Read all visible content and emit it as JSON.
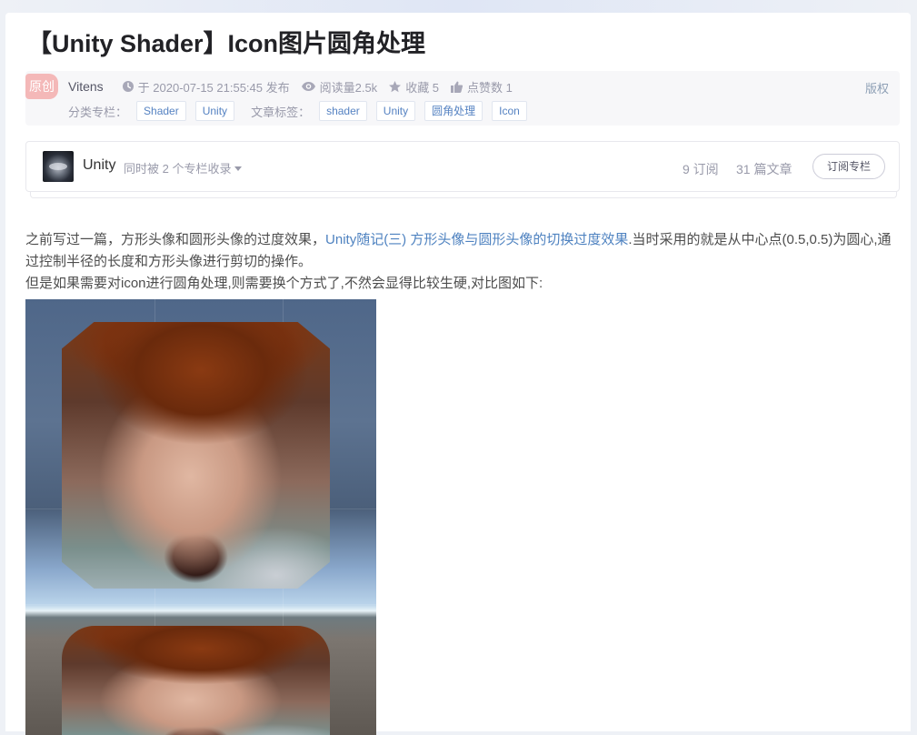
{
  "title": "【Unity Shader】Icon图片圆角处理",
  "meta": {
    "badge": "原创",
    "author": "Vitens",
    "publish_time": "于 2020-07-15 21:55:45 发布",
    "views": "阅读量2.5k",
    "favorites": "收藏 5",
    "likes": "点赞数 1",
    "copyright": "版权"
  },
  "categories": {
    "label": "分类专栏：",
    "items": [
      "Shader",
      "Unity"
    ]
  },
  "tags": {
    "label": "文章标签：",
    "items": [
      "shader",
      "Unity",
      "圆角处理",
      "Icon"
    ]
  },
  "column": {
    "name": "Unity",
    "included_text": "同时被 2 个专栏收录",
    "subscribers": "9 订阅",
    "articles": "31 篇文章",
    "subscribe_button": "订阅专栏"
  },
  "content": {
    "p1_before": "之前写过一篇，方形头像和圆形头像的过度效果，",
    "p1_link": "Unity随记(三) 方形头像与圆形头像的切换过度效果",
    "p1_after": ".当时采用的就是从中心点(0.5,0.5)为圆心,通过控制半径的长度和方形头像进行剪切的操作。",
    "p2": "但是如果需要对icon进行圆角处理,则需要换个方式了,不然会显得比较生硬,对比图如下:"
  },
  "colors": {
    "link": "#4e82c0",
    "tag_text": "#5582c2",
    "badge_bg": "#f4b8b8"
  }
}
